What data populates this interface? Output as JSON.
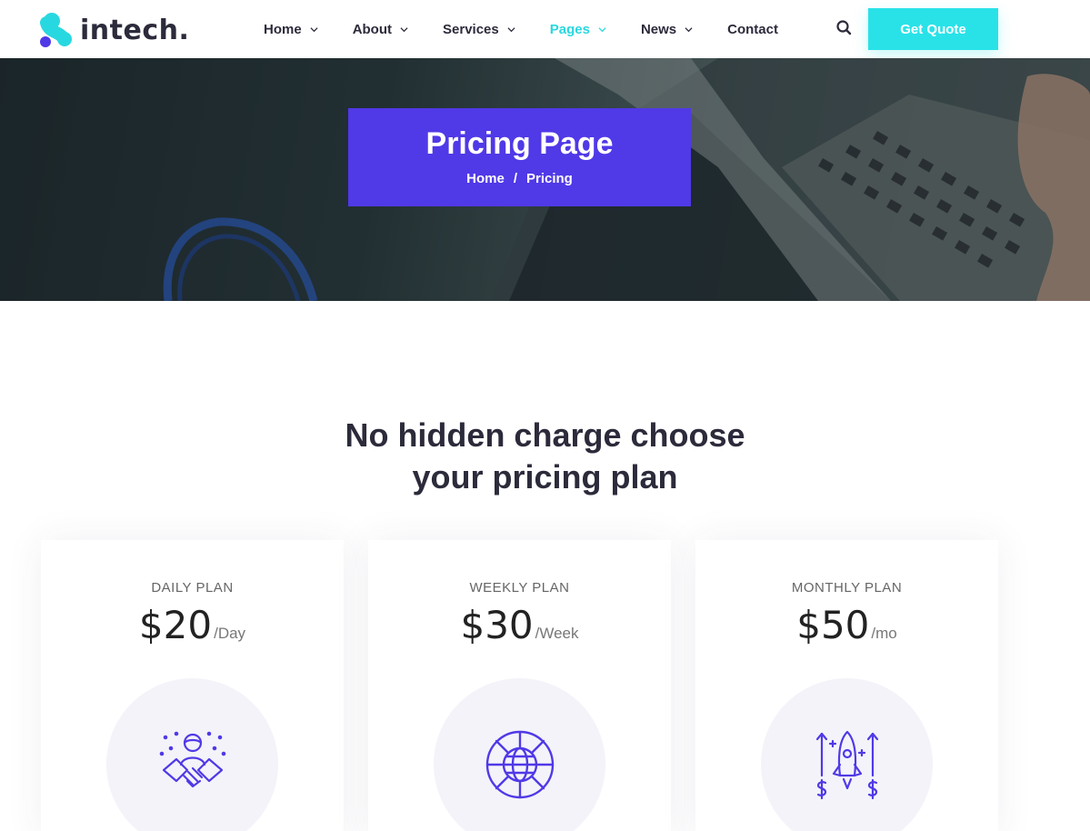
{
  "brand": {
    "name": "intech.",
    "accent": "#28e2e8",
    "primary": "#5039e7"
  },
  "nav": {
    "items": [
      {
        "label": "Home",
        "dropdown": true
      },
      {
        "label": "About",
        "dropdown": true
      },
      {
        "label": "Services",
        "dropdown": true
      },
      {
        "label": "Pages",
        "dropdown": true,
        "active": true
      },
      {
        "label": "News",
        "dropdown": true
      },
      {
        "label": "Contact",
        "dropdown": false
      }
    ],
    "search_icon": "search-icon",
    "cta_label": "Get Quote"
  },
  "hero": {
    "title": "Pricing Page",
    "breadcrumb": {
      "home": "Home",
      "separator": "/",
      "current": "Pricing"
    }
  },
  "section": {
    "heading_line1": "No hidden charge choose",
    "heading_line2": "your pricing plan"
  },
  "plans": [
    {
      "name": "DAILY PLAN",
      "price": "$20",
      "period": "/Day",
      "icon": "handshake-icon"
    },
    {
      "name": "WEEKLY PLAN",
      "price": "$30",
      "period": "/Week",
      "icon": "globe-icon"
    },
    {
      "name": "MONTHLY PLAN",
      "price": "$50",
      "period": "/mo",
      "icon": "rocket-icon"
    }
  ]
}
